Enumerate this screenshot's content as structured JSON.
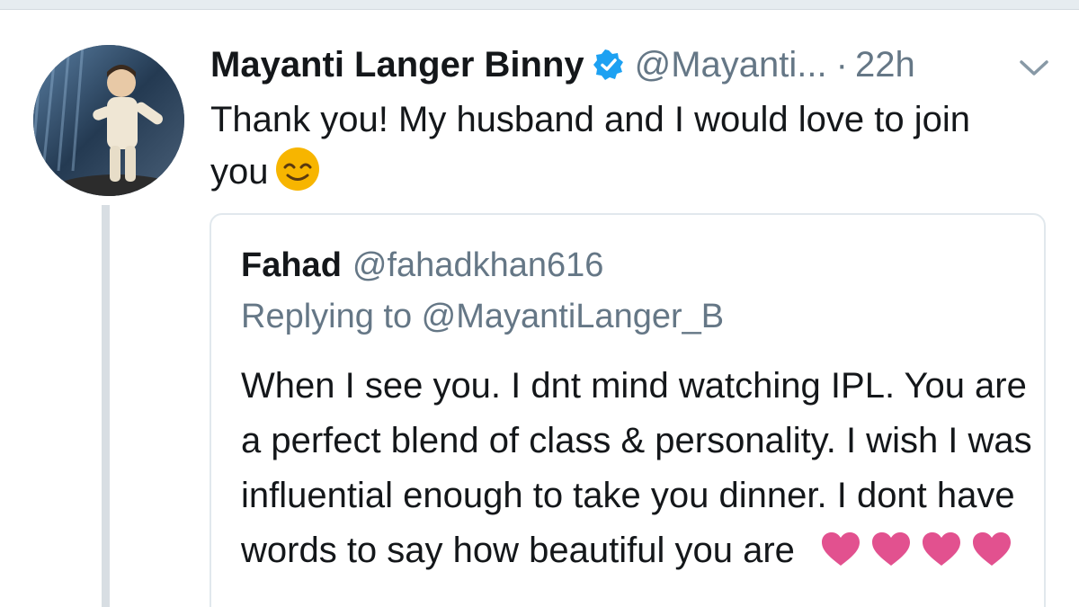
{
  "tweet": {
    "display_name": "Mayanti Langer Binny",
    "verified_icon": "verified-badge-icon",
    "handle": "@Mayanti...",
    "separator": "·",
    "time": "22h",
    "text": "Thank you! My husband and I would love to join you",
    "emoji": "smiling-face-icon",
    "menu_icon": "chevron-down-icon"
  },
  "quote": {
    "display_name": "Fahad",
    "handle": "@fahadkhan616",
    "replying_to": "Replying to @MayantiLanger_B",
    "text": "When I see you. I dnt mind watching IPL. You are a perfect blend of class & personality. I wish I was influential enough to take you dinner. I dont have words to say how beautiful you are",
    "emoji": "heart-icon",
    "heart_count": 4
  },
  "colors": {
    "text_primary": "#14171a",
    "text_secondary": "#657786",
    "verified_blue": "#1da1f2",
    "heart_pink": "#e2518f",
    "emoji_yellow": "#f7b500",
    "border": "#e1e8ed"
  }
}
